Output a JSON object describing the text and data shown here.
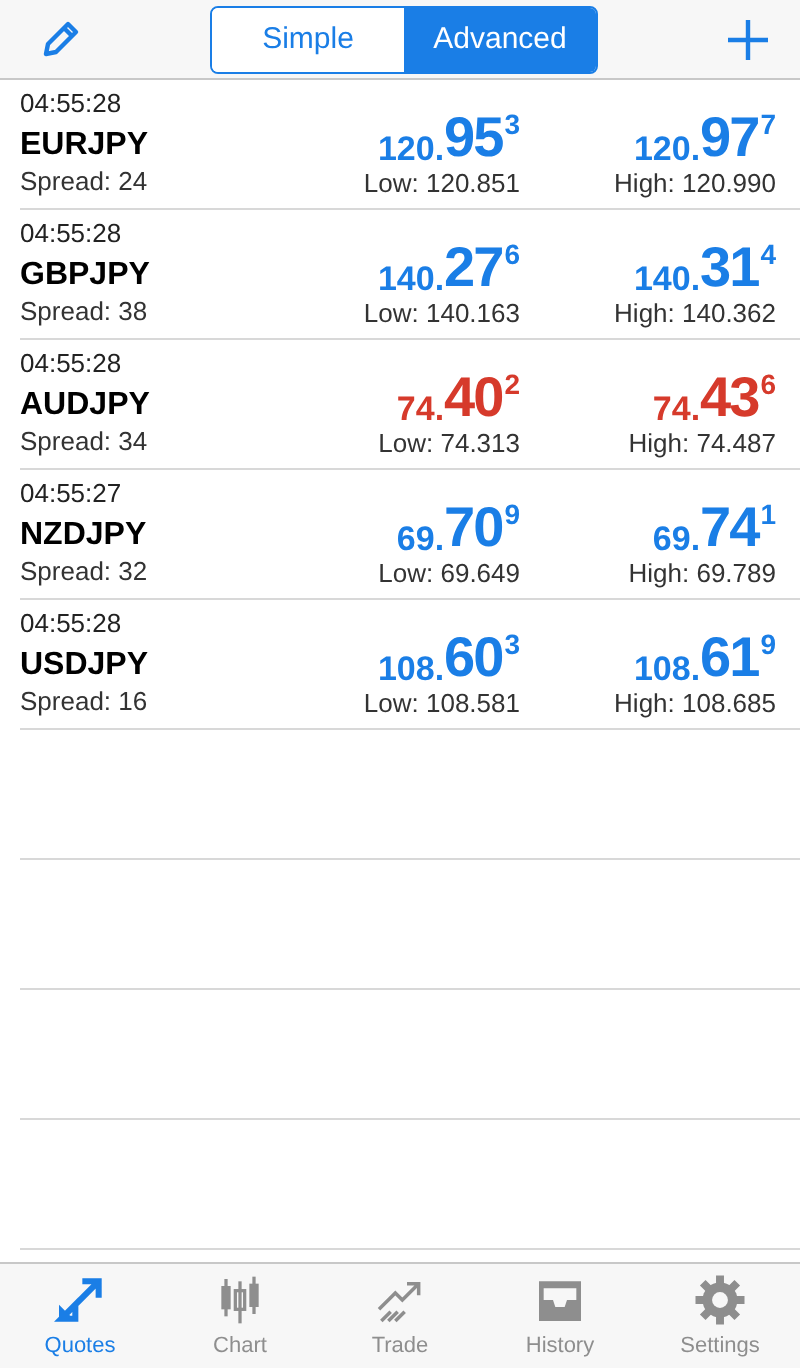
{
  "segments": [
    {
      "label": "Simple",
      "selected": false
    },
    {
      "label": "Advanced",
      "selected": true
    }
  ],
  "quotes": [
    {
      "time": "04:55:28",
      "symbol": "EURJPY",
      "spread": "Spread: 24",
      "color": "#1a7ee6",
      "bid": {
        "head": "120.",
        "big": "95",
        "pip": "3"
      },
      "ask": {
        "head": "120.",
        "big": "97",
        "pip": "7"
      },
      "low": "Low: 120.851",
      "high": "High: 120.990"
    },
    {
      "time": "04:55:28",
      "symbol": "GBPJPY",
      "spread": "Spread: 38",
      "color": "#1a7ee6",
      "bid": {
        "head": "140.",
        "big": "27",
        "pip": "6"
      },
      "ask": {
        "head": "140.",
        "big": "31",
        "pip": "4"
      },
      "low": "Low: 140.163",
      "high": "High: 140.362"
    },
    {
      "time": "04:55:28",
      "symbol": "AUDJPY",
      "spread": "Spread: 34",
      "color": "#d63a2b",
      "bid": {
        "head": "74.",
        "big": "40",
        "pip": "2"
      },
      "ask": {
        "head": "74.",
        "big": "43",
        "pip": "6"
      },
      "low": "Low: 74.313",
      "high": "High: 74.487"
    },
    {
      "time": "04:55:27",
      "symbol": "NZDJPY",
      "spread": "Spread: 32",
      "color": "#1a7ee6",
      "bid": {
        "head": "69.",
        "big": "70",
        "pip": "9"
      },
      "ask": {
        "head": "69.",
        "big": "74",
        "pip": "1"
      },
      "low": "Low: 69.649",
      "high": "High: 69.789"
    },
    {
      "time": "04:55:28",
      "symbol": "USDJPY",
      "spread": "Spread: 16",
      "color": "#1a7ee6",
      "bid": {
        "head": "108.",
        "big": "60",
        "pip": "3"
      },
      "ask": {
        "head": "108.",
        "big": "61",
        "pip": "9"
      },
      "low": "Low: 108.581",
      "high": "High: 108.685"
    }
  ],
  "tab_bar": [
    {
      "label": "Quotes",
      "kind": "quotes",
      "selected": true
    },
    {
      "label": "Chart",
      "kind": "chart",
      "selected": false
    },
    {
      "label": "Trade",
      "kind": "trade",
      "selected": false
    },
    {
      "label": "History",
      "kind": "history",
      "selected": false
    },
    {
      "label": "Settings",
      "kind": "settings",
      "selected": false
    }
  ]
}
